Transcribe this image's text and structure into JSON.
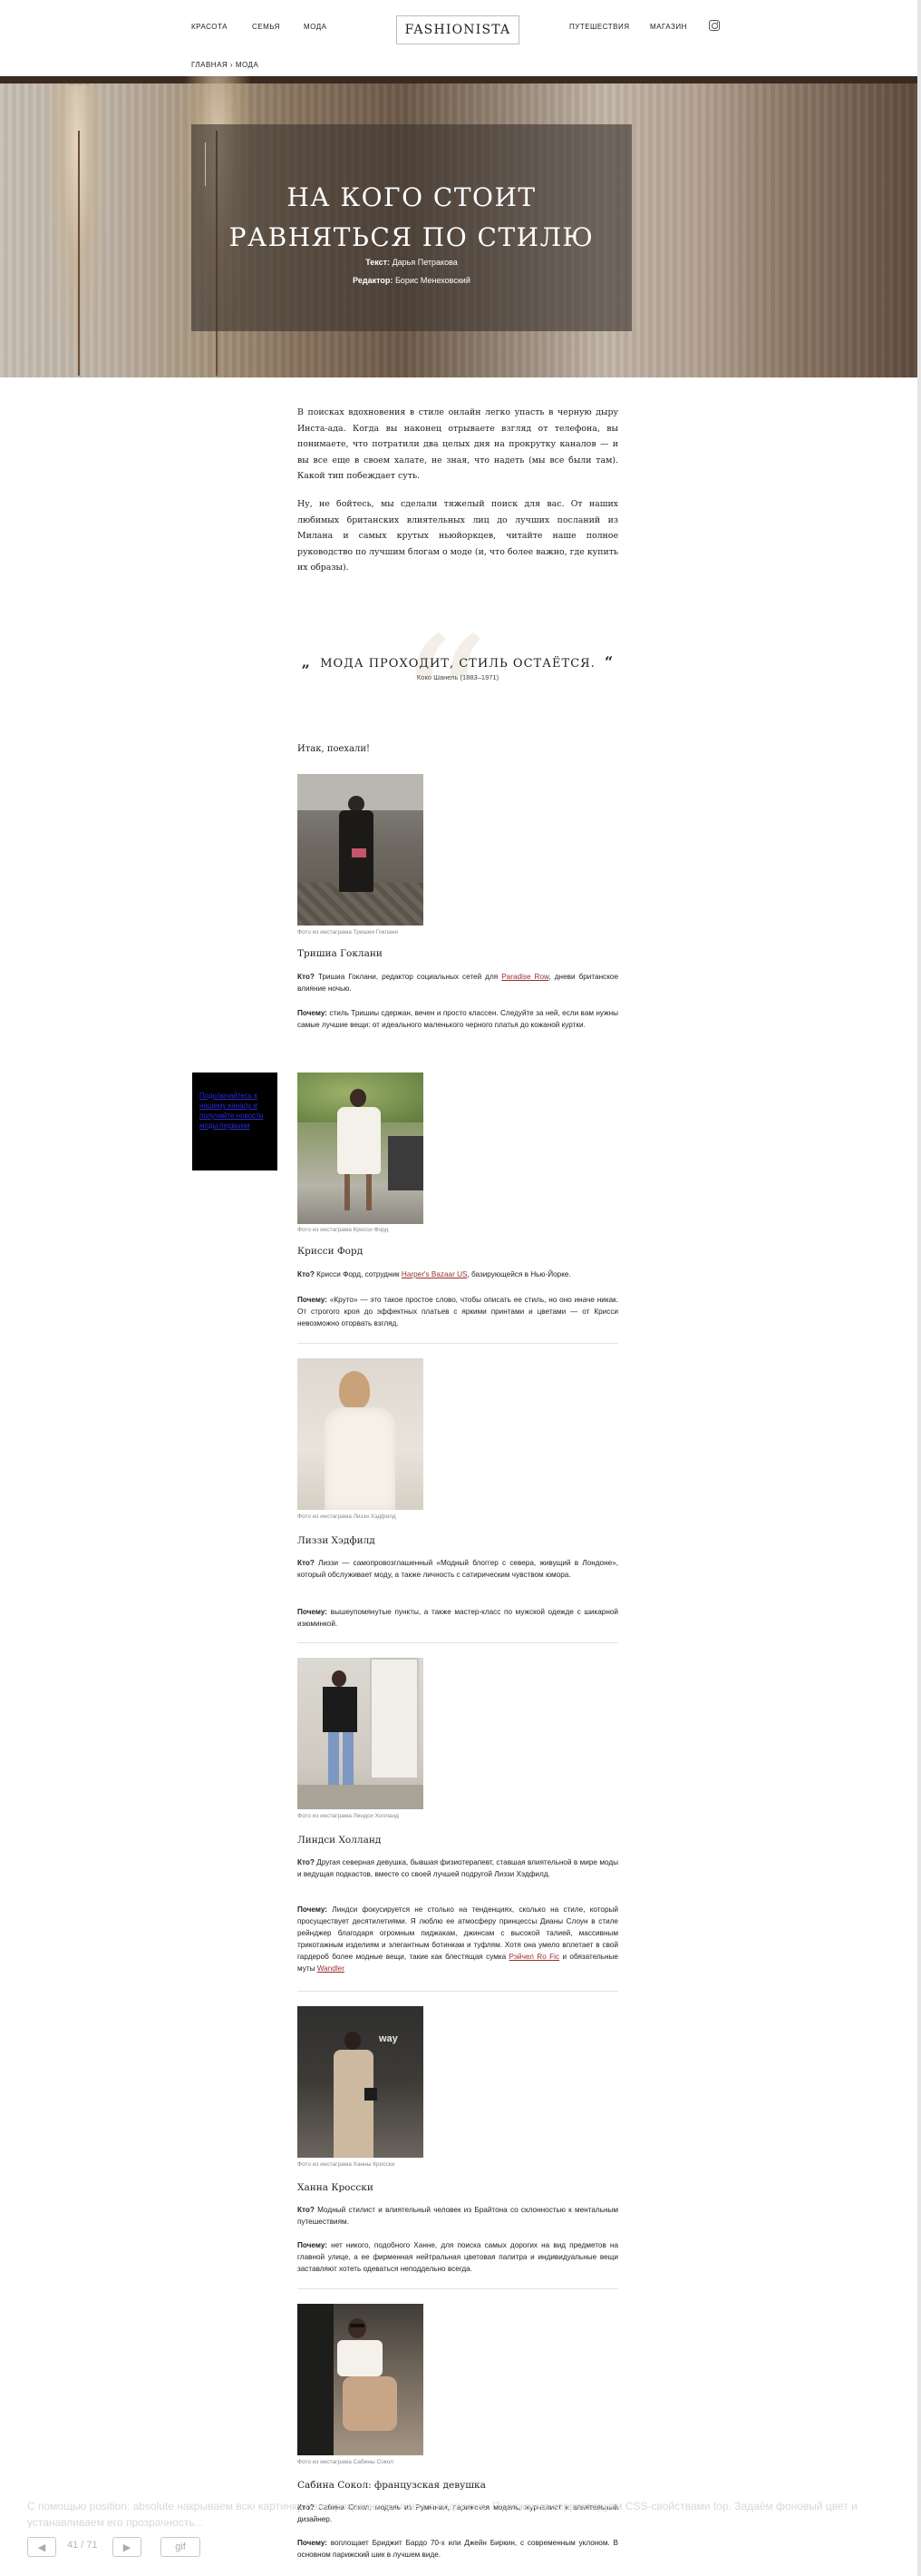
{
  "nav": {
    "left": [
      "КРАСОТА",
      "СЕМЬЯ",
      "МОДА"
    ],
    "logo": "FASHIONISTA",
    "right": [
      "ПУТЕШЕСТВИЯ",
      "МАГАЗИН"
    ],
    "instagram_icon": "instagram-icon"
  },
  "breadcrumb": {
    "home": "ГЛАВНАЯ",
    "sep": " › ",
    "current": "МОДА"
  },
  "hero": {
    "title_line1": "НА КОГО СТОИТ",
    "title_line2": "РАВНЯТЬСЯ ПО СТИЛЮ",
    "text_label": "Текст:",
    "text_author": "Дарья Петракова",
    "editor_label": "Редактор:",
    "editor_name": "Борис Менеховский"
  },
  "intro": {
    "p1": "В поисках вдохновения в стиле онлайн легко упасть в черную дыру Инста-ада. Когда вы наконец отрываете взгляд от телефона, вы понимаете, что потратили два целых дня на прокрутку каналов — и вы все еще в своем халате, не зная, что надеть (мы все были там). Какой тип побеждает суть.",
    "p2": "Ну, не бойтесь, мы сделали тяжелый поиск для вас. От наших любимых британских влиятельных лиц до лучших посланий из Милана и самых крутых ньюйоркцев, читайте наше полное руководство по лучшим блогам о моде (и, что более важно, где купить их образы)."
  },
  "quote": {
    "open": "„",
    "text": "МОДА ПРОХОДИТ, СТИЛЬ ОСТАЁТСЯ.",
    "close": "“",
    "author": "Коко Шанель (1883–1971)"
  },
  "lead_in": "Итак, поехали!",
  "side_ad": "Подключайтесь к нашему каналу и получайте новости моды первыми",
  "bloggers": [
    {
      "caption": "Фото из инстаграма Тришии Гоклани",
      "name": "Тришиа Гоклани",
      "who_label": "Кто?",
      "who_before": " Тришиа Гоклани, редактор социальных сетей для ",
      "who_link": "Paradise Row",
      "who_after": ", дневи британское влияние ночью.",
      "why_label": "Почему:",
      "why_text": " стиль Тришиы сдержан, вечен и просто классен. Следуйте за ней, если вам нужны самые лучшие вещи: от идеального маленького черного платья до кожаной куртки."
    },
    {
      "caption": "Фото из инстаграма Крисси Форд",
      "name": "Крисси Форд",
      "who_label": "Кто?",
      "who_before": " Крисси Форд, сотрудник ",
      "who_link": "Harper's Bazaar US",
      "who_after": ", базирующейся в Нью-Йорке.",
      "why_label": "Почему:",
      "why_text": " «Круто» — это такое простое слово, чтобы описать ее стиль, но оно иначе никак. От строгого кроя до эффектных платьев с яркими принтами и цветами — от Крисси невозможно оторвать взгляд."
    },
    {
      "caption": "Фото из инстаграма Лиззи Хэдфилд",
      "name": "Лиззи Хэдфилд",
      "who_label": "Кто?",
      "who_before": " Лиззи — самопровозглашенный «Модный блоггер с севера, живущий в Лондоне», который обслуживает моду, а также личность с сатирическим чувством юмора.",
      "who_link": "",
      "who_after": "",
      "why_label": "Почему:",
      "why_text": " вышеупомянутые пункты, а также мастер-класс по мужской одежде с шикарной изюминкой."
    },
    {
      "caption": "Фото из инстаграма Линдси Холланд",
      "name": "Линдси Холланд",
      "who_label": "Кто?",
      "who_before": " Другая северная девушка, бывшая физиотерапевт, ставшая влиятельной в мире моды и ведущая подкастов, вместе со своей лучшей подругой Лиззи Хэдфилд.",
      "who_link": "",
      "who_after": "",
      "why_label": "Почему:",
      "why_text": " Линдси фокусируется не столько на тенденциях, сколько на стиле, который просуществует десятилетиями. Я люблю ее атмосферу принцессы Дианы Слоун в стиле рейнджер благодаря огромным пиджакам, джинсам с высокой талией, массивным трикотажным изделиям и элегантным ботинкам и туфлям. Хотя она умело вплетает в свой гардероб более модные вещи, такие как блестящая сумка ",
      "why_link": "Рэйчел Ro Fic",
      "why_after": " и обязательные муты ",
      "why_link2": "Wandler"
    },
    {
      "caption": "Фото из инстаграма Ханны Кросски",
      "name": "Ханна Кросски",
      "who_label": "Кто?",
      "who_before": " Модный стилист и влиятельный человек из Брайтона со склонностью к ментальным путешествиям.",
      "who_link": "",
      "who_after": "",
      "why_label": "Почему:",
      "why_text": " нет никого, подобного Ханне, для поиска самых дорогих на вид предметов на главной улице, а ее фирменная нейтральная цветовая палитра и индивидуальные вещи заставляют хотеть одеваться неподдельно всегда."
    },
    {
      "caption": "Фото из инстаграма Сабины Сокол",
      "name": "Сабина Сокол: французская девушка",
      "who_label": "Кто?",
      "who_before": " Сабина Сокол, модель из Румынии, парижская модель, журналист и влиятельный дизайнер.",
      "who_link": "",
      "who_after": "",
      "why_label": "Почему:",
      "why_text": " воплощает Бриджит Бардо 70-х или Джейн Биркин, с современным уклоном. В основном парижский шик в лучшем виде."
    }
  ],
  "overlay": {
    "text": "С помощью position: absolute накрываем всю картинку полупрозрачным слоем с подписью. Положение корректируем CSS-свойствами top. Задаём фоновый цвет и устанавливаем его прозрачность...",
    "counter": "41 / 71",
    "gif": "gif",
    "prev_icon": "prev-arrow-icon",
    "next_icon": "next-arrow-icon"
  },
  "colors": {
    "link": "#9a2e2e",
    "ad_bg": "#000000",
    "ad_link": "#2b2bd8",
    "hero_panel": "#3c342e"
  }
}
